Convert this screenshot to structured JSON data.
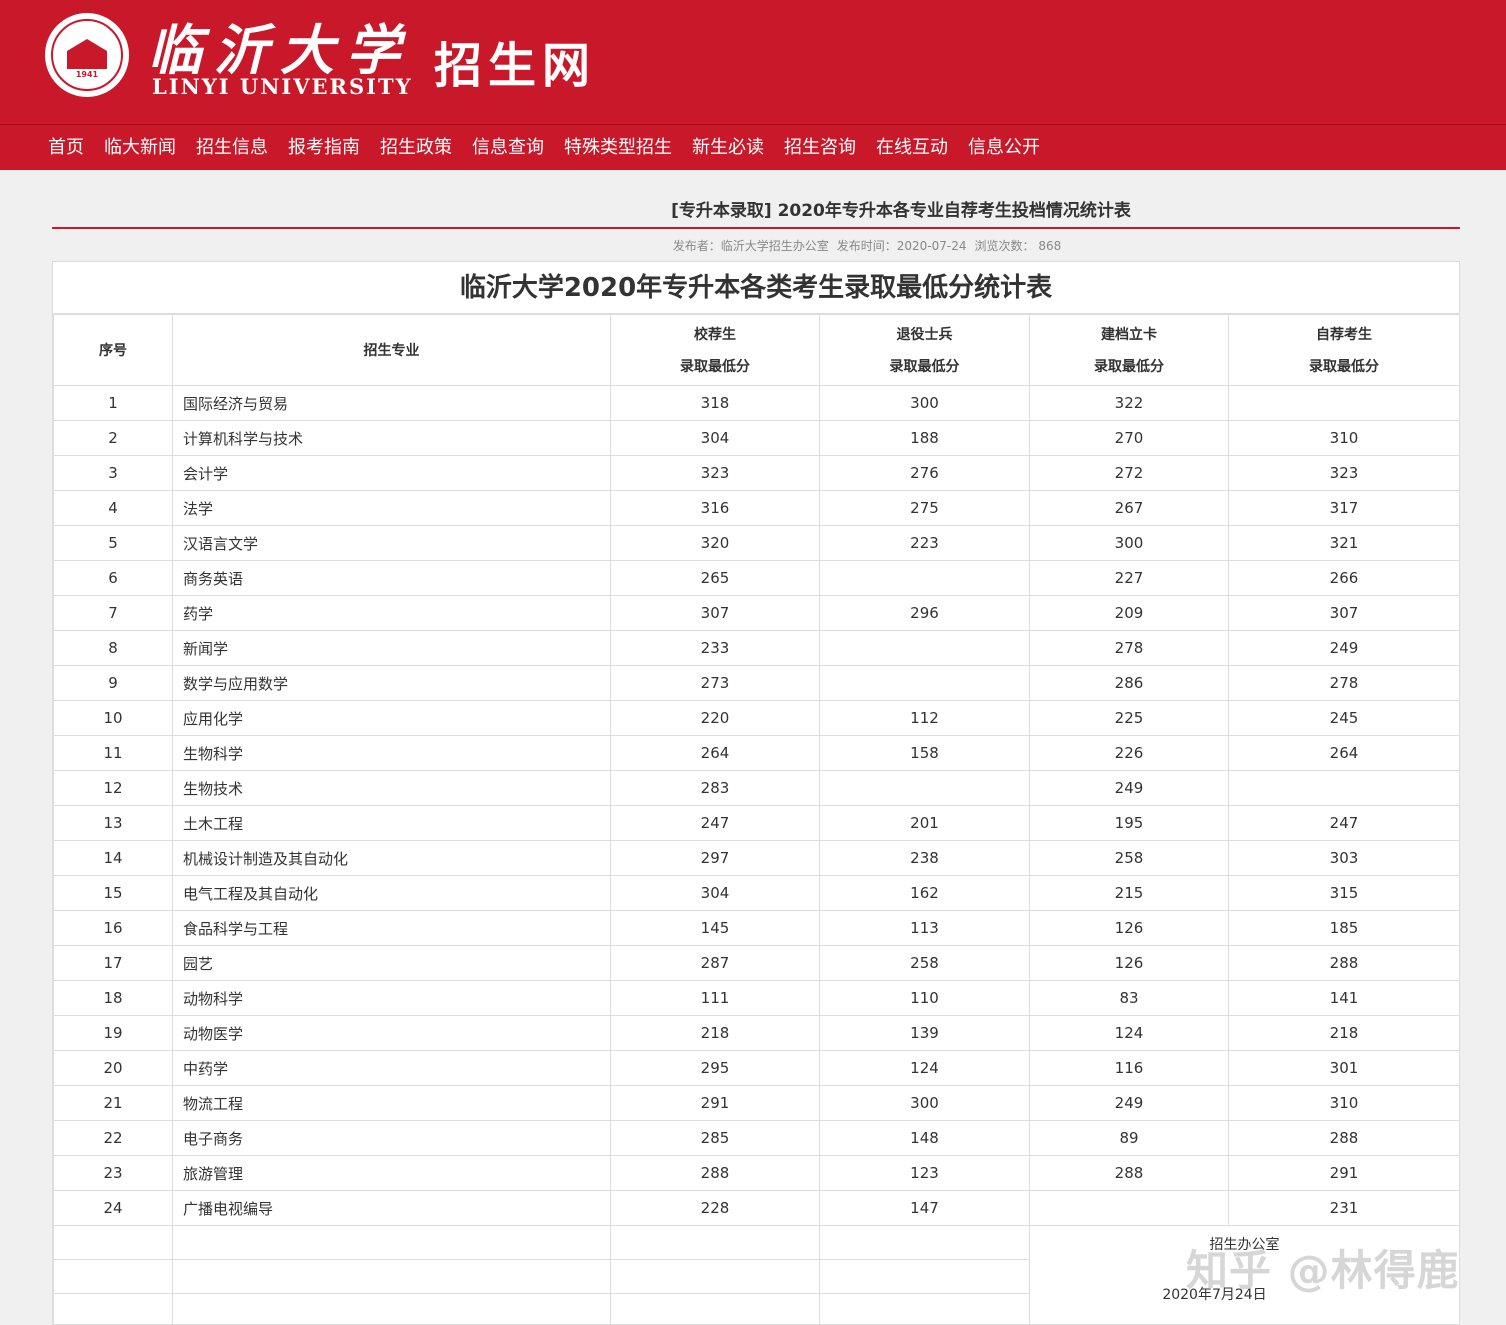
{
  "header": {
    "logo_cn": "临沂大学",
    "logo_en": "LINYI UNIVERSITY",
    "seal_year": "1941",
    "site_name": "招生网"
  },
  "nav": [
    "首页",
    "临大新闻",
    "招生信息",
    "报考指南",
    "招生政策",
    "信息查询",
    "特殊类型招生",
    "新生必读",
    "招生咨询",
    "在线互动",
    "信息公开"
  ],
  "article": {
    "title": "[专升本录取] 2020年专升本各专业自荐考生投档情况统计表",
    "publisher": "发布者：临沂大学招生办公室",
    "publish_time": "发布时间：2020-07-24",
    "views": "浏览次数：  868"
  },
  "table": {
    "title": "临沂大学2020年专升本各类考生录取最低分统计表",
    "headers": {
      "no": "序号",
      "major": "招生专业",
      "c1_top": "校荐生",
      "c1_bottom": "录取最低分",
      "c2_top": "退役士兵",
      "c2_bottom": "录取最低分",
      "c3_top": "建档立卡",
      "c3_bottom": "录取最低分",
      "c4_top": "自荐考生",
      "c4_bottom": "录取最低分"
    },
    "rows": [
      [
        "1",
        "国际经济与贸易",
        "318",
        "300",
        "322",
        ""
      ],
      [
        "2",
        "计算机科学与技术",
        "304",
        "188",
        "270",
        "310"
      ],
      [
        "3",
        "会计学",
        "323",
        "276",
        "272",
        "323"
      ],
      [
        "4",
        "法学",
        "316",
        "275",
        "267",
        "317"
      ],
      [
        "5",
        "汉语言文学",
        "320",
        "223",
        "300",
        "321"
      ],
      [
        "6",
        "商务英语",
        "265",
        "",
        "227",
        "266"
      ],
      [
        "7",
        "药学",
        "307",
        "296",
        "209",
        "307"
      ],
      [
        "8",
        "新闻学",
        "233",
        "",
        "278",
        "249"
      ],
      [
        "9",
        "数学与应用数学",
        "273",
        "",
        "286",
        "278"
      ],
      [
        "10",
        "应用化学",
        "220",
        "112",
        "225",
        "245"
      ],
      [
        "11",
        "生物科学",
        "264",
        "158",
        "226",
        "264"
      ],
      [
        "12",
        "生物技术",
        "283",
        "",
        "249",
        ""
      ],
      [
        "13",
        "土木工程",
        "247",
        "201",
        "195",
        "247"
      ],
      [
        "14",
        "机械设计制造及其自动化",
        "297",
        "238",
        "258",
        "303"
      ],
      [
        "15",
        "电气工程及其自动化",
        "304",
        "162",
        "215",
        "315"
      ],
      [
        "16",
        "食品科学与工程",
        "145",
        "113",
        "126",
        "185"
      ],
      [
        "17",
        "园艺",
        "287",
        "258",
        "126",
        "288"
      ],
      [
        "18",
        "动物科学",
        "111",
        "110",
        "83",
        "141"
      ],
      [
        "19",
        "动物医学",
        "218",
        "139",
        "124",
        "218"
      ],
      [
        "20",
        "中药学",
        "295",
        "124",
        "116",
        "301"
      ],
      [
        "21",
        "物流工程",
        "291",
        "300",
        "249",
        "310"
      ],
      [
        "22",
        "电子商务",
        "285",
        "148",
        "89",
        "288"
      ],
      [
        "23",
        "旅游管理",
        "288",
        "123",
        "288",
        "291"
      ],
      [
        "24",
        "广播电视编导",
        "228",
        "147",
        "",
        "231"
      ]
    ],
    "signature": "招生办公室",
    "signature_date": "2020年7月24日"
  },
  "watermark": "知乎 @林得鹿",
  "colors": {
    "brand_red": "#c8182a"
  }
}
